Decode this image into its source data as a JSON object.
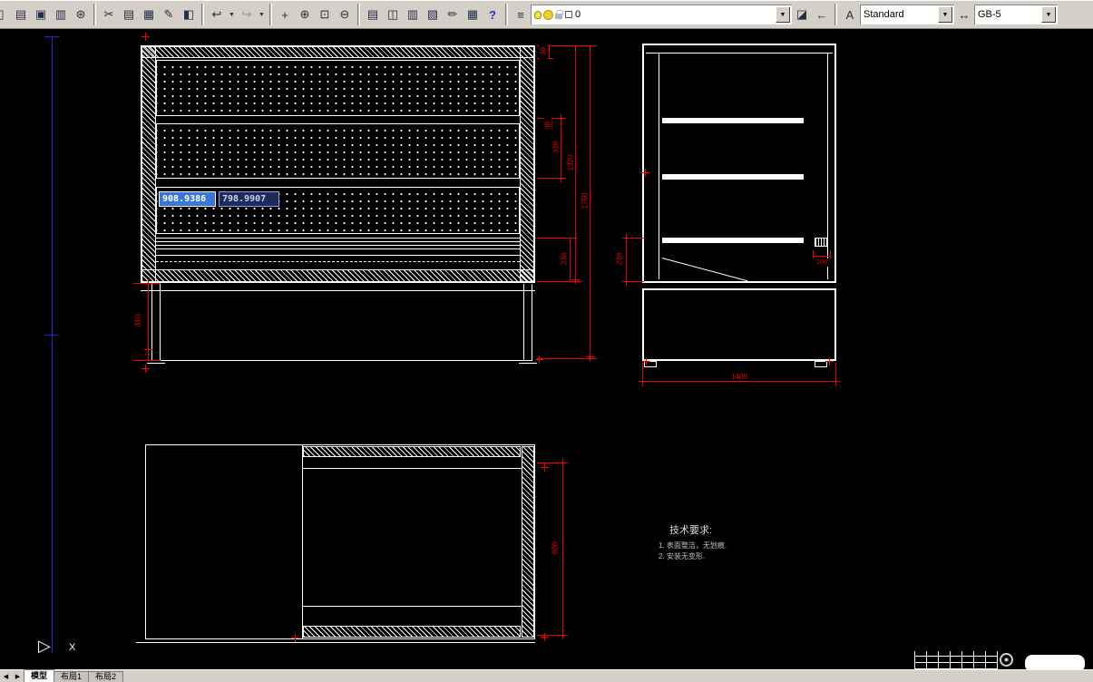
{
  "toolbar": {
    "dropdown_glyph": "▼",
    "icons": [
      {
        "name": "new",
        "glyph": "▯"
      },
      {
        "name": "print",
        "glyph": "▤"
      },
      {
        "name": "print-preview",
        "glyph": "▣"
      },
      {
        "name": "publish",
        "glyph": "▥"
      },
      {
        "name": "hyperlink",
        "glyph": "⊛"
      },
      {
        "name": "cut",
        "glyph": "✂"
      },
      {
        "name": "copy",
        "glyph": "▤"
      },
      {
        "name": "paste",
        "glyph": "▦"
      },
      {
        "name": "match-properties",
        "glyph": "✎"
      },
      {
        "name": "block-editor",
        "glyph": "◧"
      },
      {
        "name": "undo",
        "glyph": "↩"
      },
      {
        "name": "redo",
        "glyph": "↪"
      },
      {
        "name": "pan",
        "glyph": "+"
      },
      {
        "name": "zoom-realtime",
        "glyph": "⊕"
      },
      {
        "name": "zoom-window",
        "glyph": "⊡"
      },
      {
        "name": "zoom-previous",
        "glyph": "⊖"
      },
      {
        "name": "properties",
        "glyph": "▤"
      },
      {
        "name": "designcenter",
        "glyph": "◫"
      },
      {
        "name": "tool-palettes",
        "glyph": "▥"
      },
      {
        "name": "sheet-set-manager",
        "glyph": "▧"
      },
      {
        "name": "markup",
        "glyph": "✏"
      },
      {
        "name": "quickcalc",
        "glyph": "▦"
      },
      {
        "name": "help",
        "glyph": "?"
      },
      {
        "name": "layer-properties",
        "glyph": "≡"
      },
      {
        "name": "layer-states",
        "glyph": "◪"
      },
      {
        "name": "layer-previous",
        "glyph": "←"
      },
      {
        "name": "text-style",
        "glyph": "A"
      },
      {
        "name": "dim-style",
        "glyph": "↔"
      }
    ],
    "layer_combo": {
      "layer_name": "0"
    },
    "text_style_combo": {
      "value": "Standard"
    },
    "dim_style_combo": {
      "value": "GB-5"
    }
  },
  "canvas": {
    "dynamic_input": {
      "field_x": "908.9386",
      "field_y": "798.9907"
    },
    "dimensions": {
      "front_view": {
        "top_band": "30",
        "panel_gap": "38",
        "panel_pitch": "338",
        "body_height": "1320",
        "overall_height": "1750",
        "bottom_section": "238",
        "base_height": "310"
      },
      "side_view": {
        "bottom_section": "238",
        "slot_width": "100",
        "overall_width": "1400"
      },
      "top_view": {
        "depth": "800"
      }
    },
    "tech_requirements": {
      "title": "技术要求:",
      "notes": [
        "1. 表面整洁，无划痕.",
        "2. 安装无变形."
      ]
    },
    "ucs": {
      "arrow_glyph": "▷",
      "x_label": "X"
    }
  },
  "tab_bar": {
    "nav_prev": "◀",
    "nav_next": "▶",
    "tabs": [
      {
        "label": "模型"
      },
      {
        "label": "布局1"
      },
      {
        "label": "布局2"
      }
    ]
  },
  "colors": {
    "dimension": "#f20000",
    "drawing_line": "#ffffff",
    "frame_line": "#2a2ad0",
    "active_field_bg": "#3a76d6",
    "tooltip_field_bg": "#1e2a5e"
  }
}
